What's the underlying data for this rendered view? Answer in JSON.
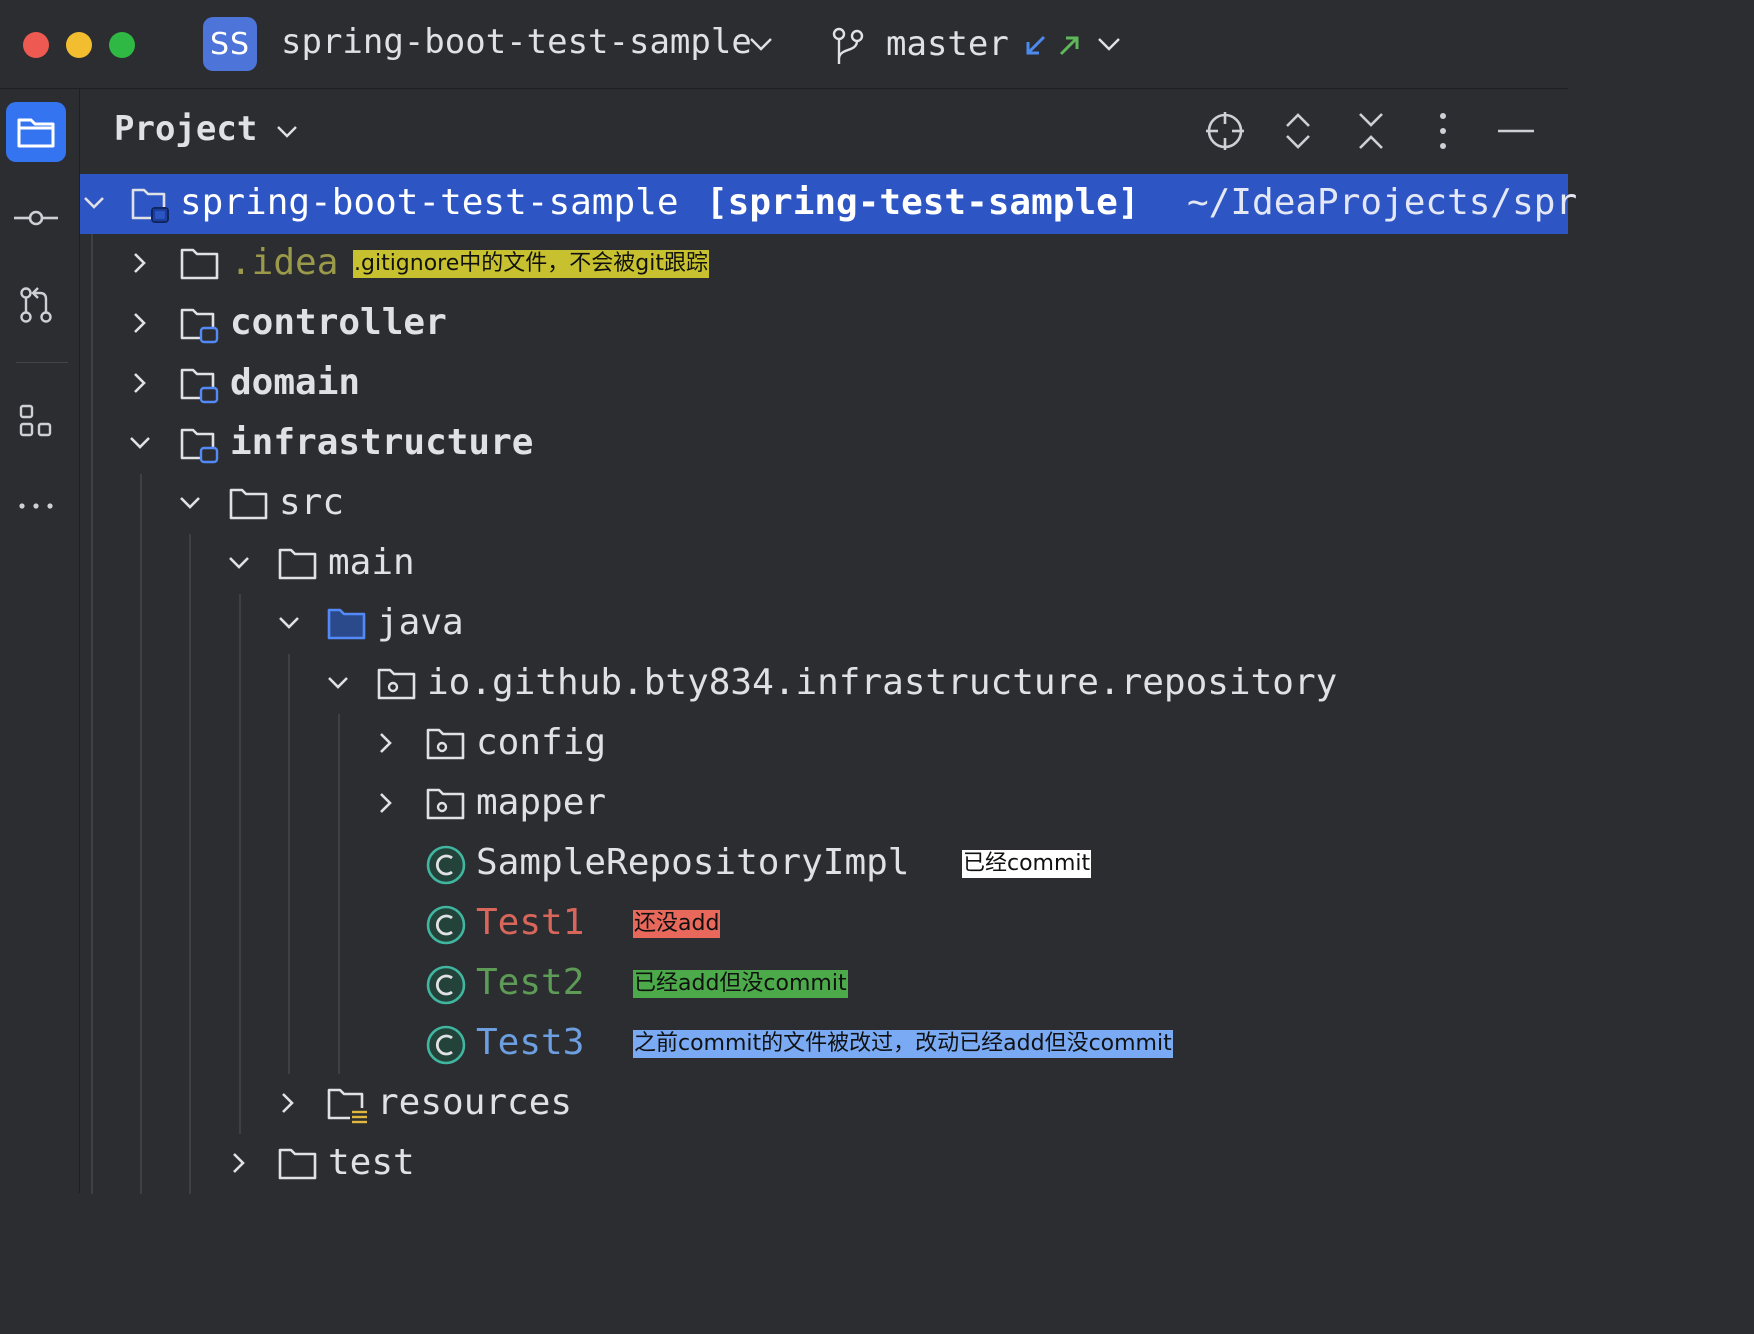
{
  "titlebar": {
    "project_badge": "SS",
    "project_name": "spring-boot-test-sample",
    "branch": "master",
    "icons": [
      "chevron-down-icon",
      "branch-icon",
      "incoming-arrow-icon",
      "outgoing-arrow-icon"
    ]
  },
  "toolstrip": {
    "icons": [
      "folder-icon",
      "commit-icon",
      "pull-request-icon",
      "structure-icon",
      "more-icon"
    ]
  },
  "panel": {
    "title": "Project",
    "tools": [
      "locate-icon",
      "expand-all-icon",
      "collapse-all-icon",
      "more-vertical-icon",
      "minimize-icon"
    ]
  },
  "tree": {
    "root": {
      "name": "spring-boot-test-sample",
      "module": "[spring-test-sample]",
      "path": "~/IdeaProjects/spr"
    },
    "items": [
      {
        "name": ".idea",
        "note": ".gitignore中的文件，不会被git跟踪"
      },
      {
        "name": "controller"
      },
      {
        "name": "domain"
      },
      {
        "name": "infrastructure"
      },
      {
        "name": "src"
      },
      {
        "name": "main"
      },
      {
        "name": "java"
      },
      {
        "name": "io.github.bty834.infrastructure.repository"
      },
      {
        "name": "config"
      },
      {
        "name": "mapper"
      },
      {
        "name": "SampleRepositoryImpl",
        "note": "已经commit"
      },
      {
        "name": "Test1",
        "note": "还没add"
      },
      {
        "name": "Test2",
        "note": "已经add但没commit"
      },
      {
        "name": "Test3",
        "note": "之前commit的文件被改过，改动已经add但没commit"
      },
      {
        "name": "resources"
      },
      {
        "name": "test"
      }
    ]
  },
  "colors": {
    "selection": "#2e55c4",
    "ignored": "#9b9a4a",
    "unversioned": "#d9665b",
    "added": "#5d9b56",
    "modified": "#6c9ee0",
    "note_yellow": "#c7c12f",
    "note_red": "#e8695c",
    "note_green": "#4caa4a",
    "note_blue": "#7aaaf3"
  }
}
